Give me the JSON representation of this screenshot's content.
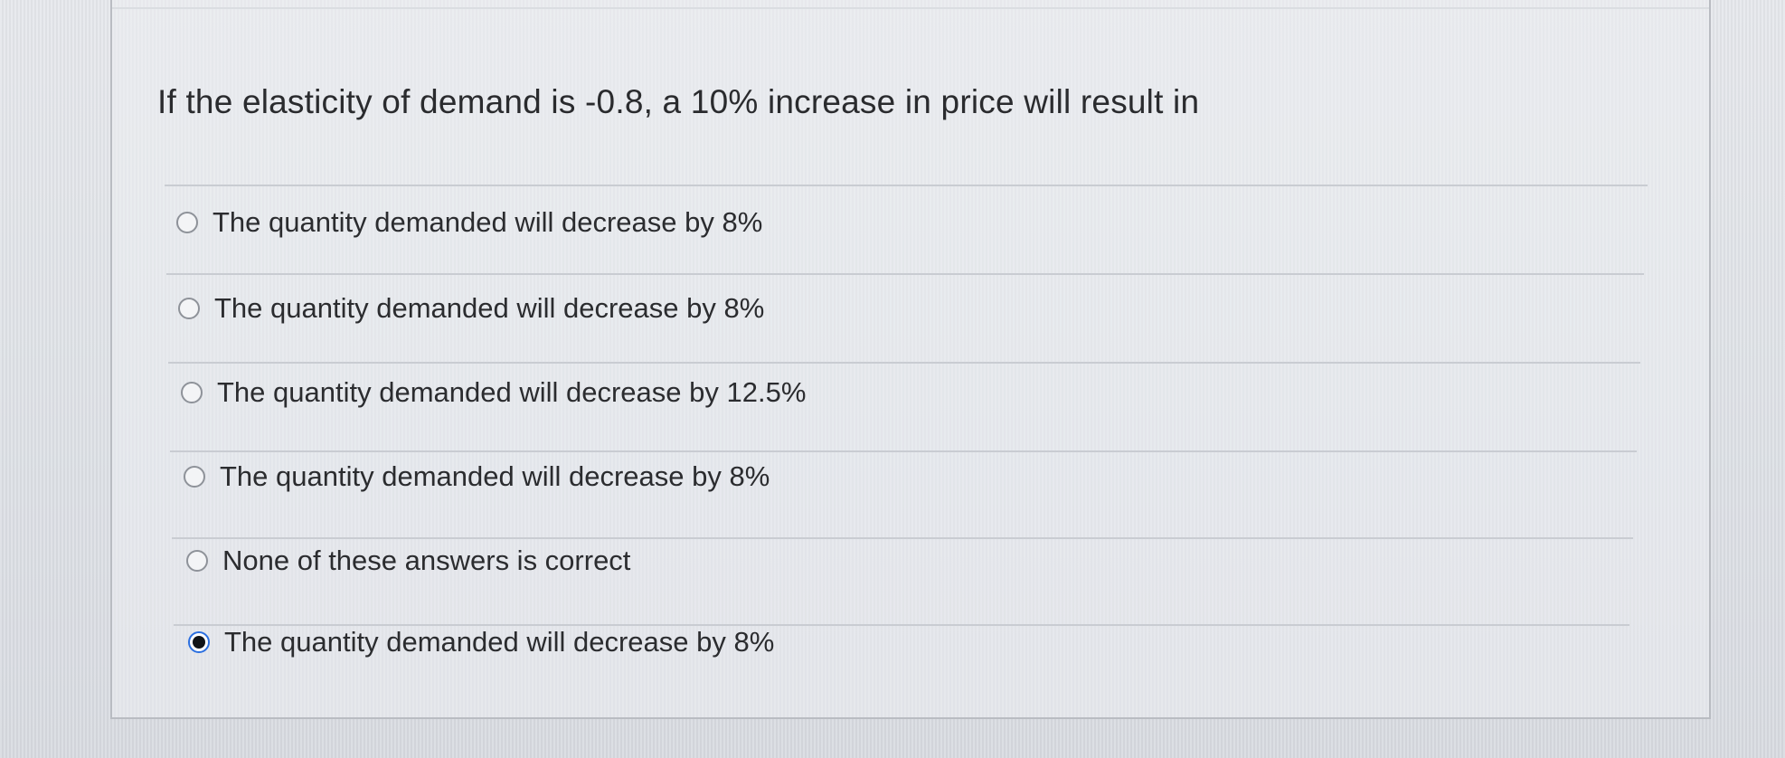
{
  "question": {
    "text": "If the elasticity of demand is -0.8, a 10% increase in price will result in"
  },
  "options": [
    {
      "label": "The quantity demanded will decrease by 8%",
      "selected": false
    },
    {
      "label": "The quantity demanded will decrease by 8%",
      "selected": false
    },
    {
      "label": "The quantity demanded will decrease by 12.5%",
      "selected": false
    },
    {
      "label": "The quantity demanded will decrease by 8%",
      "selected": false
    },
    {
      "label": "None of these answers is correct",
      "selected": false
    },
    {
      "label": "The quantity demanded will decrease by 8%",
      "selected": true
    }
  ],
  "colors": {
    "selected_radio_ring": "#2b6fe0",
    "selected_radio_dot": "#111418",
    "text": "#2b2c2f"
  }
}
